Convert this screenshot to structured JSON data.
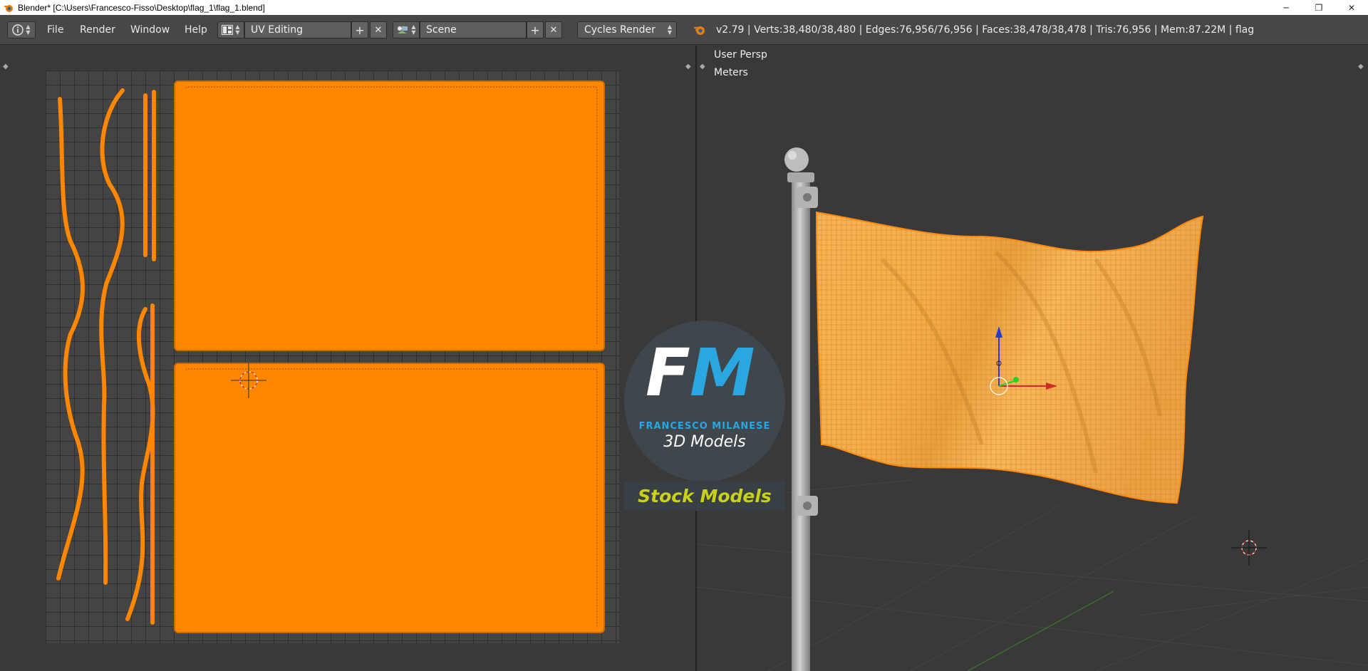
{
  "window": {
    "title": "Blender* [C:\\Users\\Francesco-Fisso\\Desktop\\flag_1\\flag_1.blend]",
    "controls": [
      "─",
      "❐",
      "✕"
    ]
  },
  "header": {
    "info_icon": "i",
    "menus": [
      "File",
      "Render",
      "Window",
      "Help"
    ],
    "screen_layout": "UV Editing",
    "scene": "Scene",
    "render_engine": "Cycles Render",
    "add_symbol": "+",
    "remove_symbol": "✕",
    "stats": "v2.79 | Verts:38,480/38,480 | Edges:76,956/76,956 | Faces:38,478/38,478 | Tris:76,956 | Mem:87.22M | flag"
  },
  "viewport": {
    "view_label": "User Persp",
    "units_label": "Meters"
  },
  "watermark": {
    "logo_letter_1": "F",
    "logo_letter_2": "M",
    "name": "FRANCESCO MILANESE",
    "tagline": "3D Models",
    "badge": "Stock Models"
  },
  "colors": {
    "uv_orange": "#ff8700",
    "flag_orange": "#f0a640",
    "logo_blue": "#2aa6e0",
    "badge_green": "#c9d11a"
  },
  "icons": {
    "app": "blender-logo-icon",
    "editor_type": "info-icon",
    "layout": "screen-layout-icon",
    "scene": "scene-icon",
    "render": "blender-render-icon"
  }
}
